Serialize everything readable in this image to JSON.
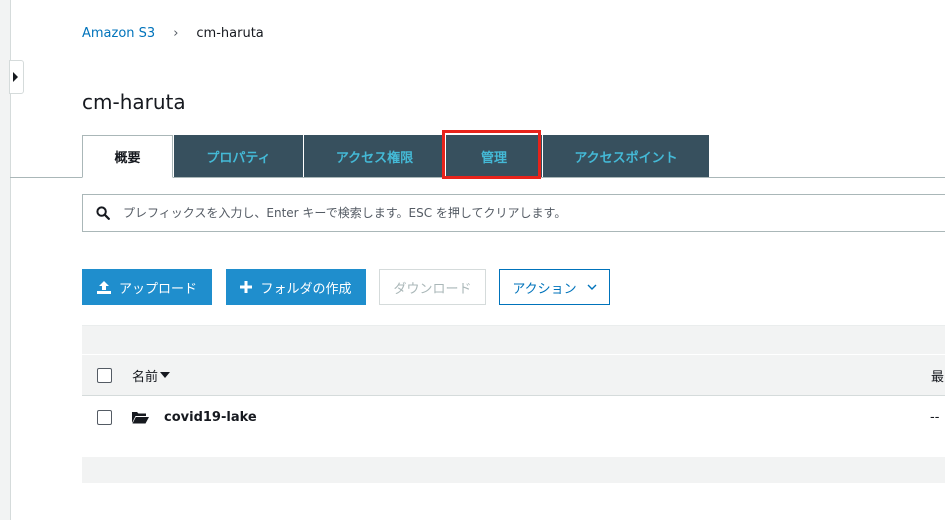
{
  "breadcrumb": {
    "root": "Amazon S3",
    "separator": "›",
    "current": "cm-haruta"
  },
  "page": {
    "title": "cm-haruta"
  },
  "tabs": [
    {
      "label": "概要",
      "active": true
    },
    {
      "label": "プロパティ",
      "active": false
    },
    {
      "label": "アクセス権限",
      "active": false
    },
    {
      "label": "管理",
      "active": false,
      "highlighted": true
    },
    {
      "label": "アクセスポイント",
      "active": false
    }
  ],
  "search": {
    "placeholder": "プレフィックスを入力し、Enter キーで検索します。ESC を押してクリアします。"
  },
  "toolbar": {
    "upload": "アップロード",
    "create_folder": "フォルダの作成",
    "download": "ダウンロード",
    "actions": "アクション"
  },
  "table": {
    "columns": [
      "名前",
      "最"
    ],
    "rows": [
      {
        "name": "covid19-lake",
        "last_modified": "--",
        "type": "folder"
      }
    ]
  },
  "colors": {
    "tab_bg": "#37505e",
    "tab_text": "#44b9d6",
    "primary_button": "#1f8ecd",
    "highlight": "#e8231b",
    "link": "#0073bb"
  }
}
